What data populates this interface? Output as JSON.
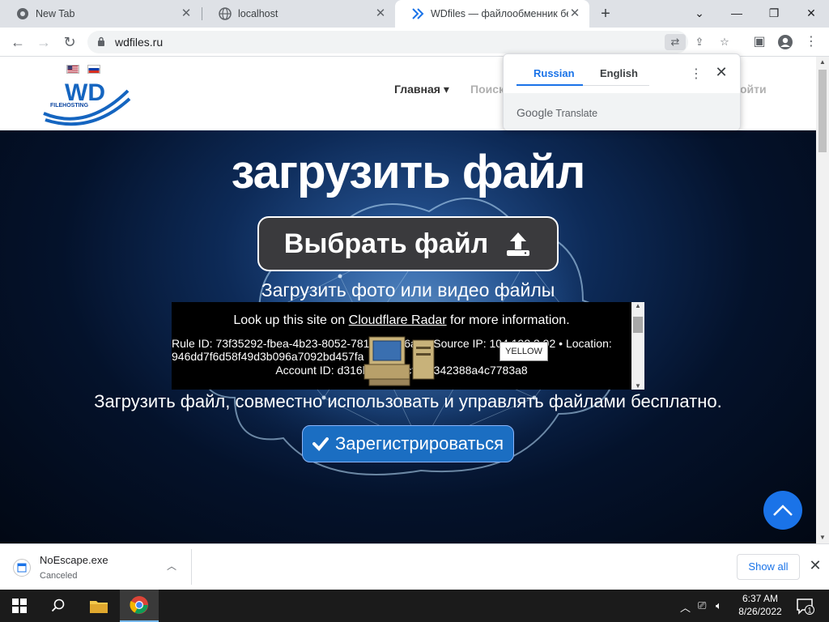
{
  "browser": {
    "tabs": [
      {
        "title": "New Tab"
      },
      {
        "title": "localhost"
      },
      {
        "title": "WDfiles — файлообменник бес"
      }
    ],
    "url": "wdfiles.ru"
  },
  "site": {
    "nav": {
      "home": "Главная ▾",
      "search": "Поиск",
      "login": "ойти"
    },
    "hero_title": "загрузить файл",
    "choose_file": "Выбрать файл",
    "upload_sub": "Загрузить фото или видео файлы",
    "tagline": "Загрузить файл, совместно использовать и управлять файлами бесплатно.",
    "register": "Зарегистрироваться",
    "logo_text": "WD",
    "logo_sub": "FILEHOSTING"
  },
  "cloudflare": {
    "lookup_prefix": "Look up this site on ",
    "lookup_link": "Cloudflare Radar",
    "lookup_suffix": " for more information.",
    "rule_line": "Rule ID: 73f35292-fbea-4b23-8052-7816d9f6d6a2 • Source IP: 104.192.3.92 • Location: 946dd7f6d58f49d3b096a7092bd457fa",
    "account_line": "Account ID: d316b87c100cf3d6342388a4c7783a8"
  },
  "tooltip": "YELLOW",
  "translate_popup": {
    "tab_active": "Russian",
    "tab_inactive": "English",
    "brand_google": "Google",
    "brand_translate": "Translate"
  },
  "download": {
    "filename": "NoEscape.exe",
    "status": "Canceled",
    "show_all": "Show all"
  },
  "taskbar": {
    "time": "6:37 AM",
    "date": "8/26/2022",
    "notification_count": "1"
  },
  "colors": {
    "accent": "#1a73e8",
    "register_bg": "#1b6ec2",
    "hero_dark": "#04122b"
  }
}
